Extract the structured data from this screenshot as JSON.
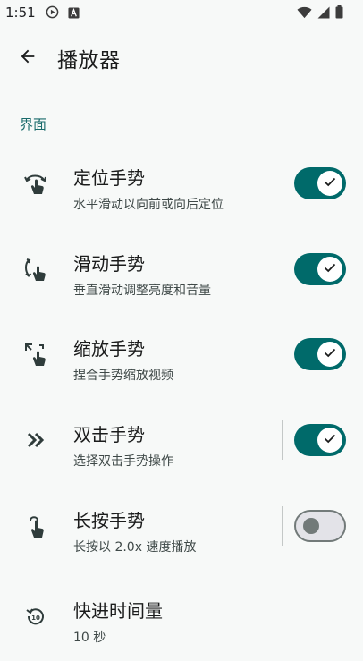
{
  "status_bar": {
    "time": "1:51",
    "left_icons": [
      "play-circle-icon",
      "text-badge-icon"
    ],
    "right_icons": [
      "wifi-icon",
      "signal-icon",
      "battery-icon"
    ]
  },
  "app_bar": {
    "back_icon": "arrow-back-icon",
    "title": "播放器"
  },
  "section": {
    "title": "界面"
  },
  "settings": [
    {
      "icon": "swipe-horizontal-icon",
      "title": "定位手势",
      "subtitle": "水平滑动以向前或向后定位",
      "enabled": true
    },
    {
      "icon": "swipe-vertical-icon",
      "title": "滑动手势",
      "subtitle": "垂直滑动调整亮度和音量",
      "enabled": true
    },
    {
      "icon": "pinch-icon",
      "title": "缩放手势",
      "subtitle": "捏合手势缩放视频",
      "enabled": true
    },
    {
      "icon": "double-chevron-icon",
      "title": "双击手势",
      "subtitle": "选择双击手势操作",
      "enabled": true
    },
    {
      "icon": "touch-hold-icon",
      "title": "长按手势",
      "subtitle": "长按以 2.0x 速度播放",
      "enabled": false
    },
    {
      "icon": "replay-10-icon",
      "title": "快进时间量",
      "subtitle": "10 秒"
    }
  ],
  "colors": {
    "accent": "#006a6a",
    "section_header": "#1a6b6b",
    "background": "#f7f9f8",
    "switch_off_track": "#e3e3e8",
    "switch_off_thumb": "#727a79"
  }
}
